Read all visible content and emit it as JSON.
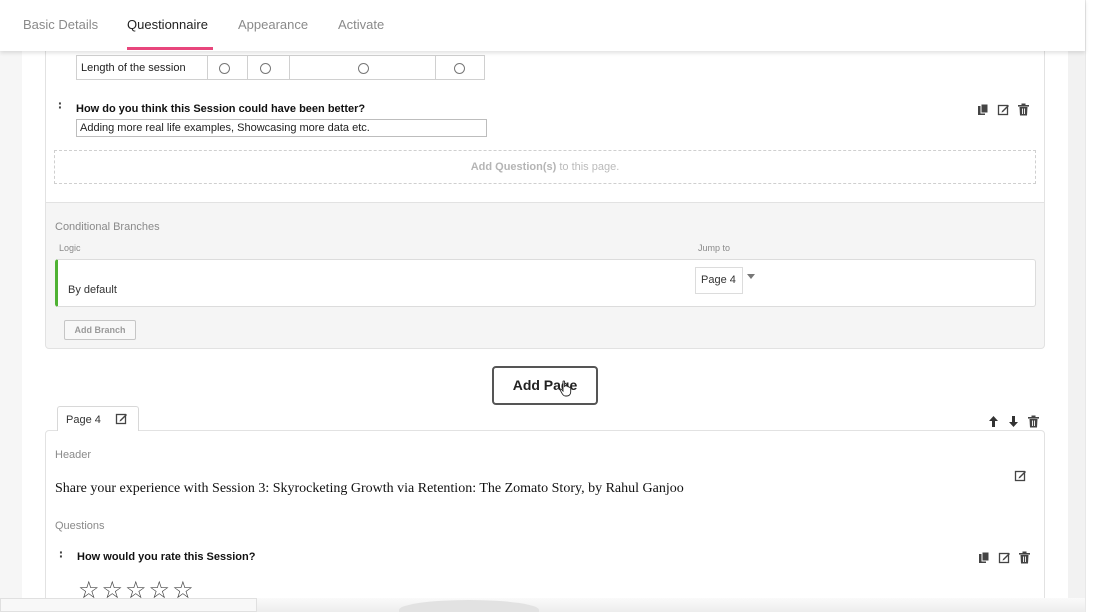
{
  "tabs": [
    "Basic Details",
    "Questionnaire",
    "Appearance",
    "Activate"
  ],
  "page3": {
    "matrix_row_label": "Length of the session",
    "question_title": "How do you think this Session could have been better?",
    "answer_value": "Adding more real life examples, Showcasing more data etc.",
    "add_question_bold": "Add Question(s)",
    "add_question_rest": " to this page."
  },
  "branches": {
    "title": "Conditional Branches",
    "col_logic": "Logic",
    "col_jump": "Jump to",
    "row_label": "By default",
    "jump_value": "Page 4",
    "add_branch_label": "Add Branch"
  },
  "add_page_label": "Add Page",
  "page4": {
    "tab_label": "Page 4",
    "header_label": "Header",
    "header_text": "Share your experience with Session 3: Skyrocketing Growth via Retention: The Zomato Story, by Rahul Ganjoo",
    "questions_label": "Questions",
    "question_title": "How would you rate this Session?",
    "stars": "☆☆☆☆☆",
    "rating_max": 5,
    "rating_value": 0
  },
  "icons": {
    "copy": "copy-icon",
    "edit": "edit-icon",
    "delete": "trash-icon",
    "up": "arrow-up-icon",
    "down": "arrow-down-icon",
    "drag": "drag-handle-icon",
    "cursor": "hand-cursor-icon"
  },
  "colors": {
    "active_tab_underline": "#e8467c",
    "branch_accent": "#4fb233"
  }
}
